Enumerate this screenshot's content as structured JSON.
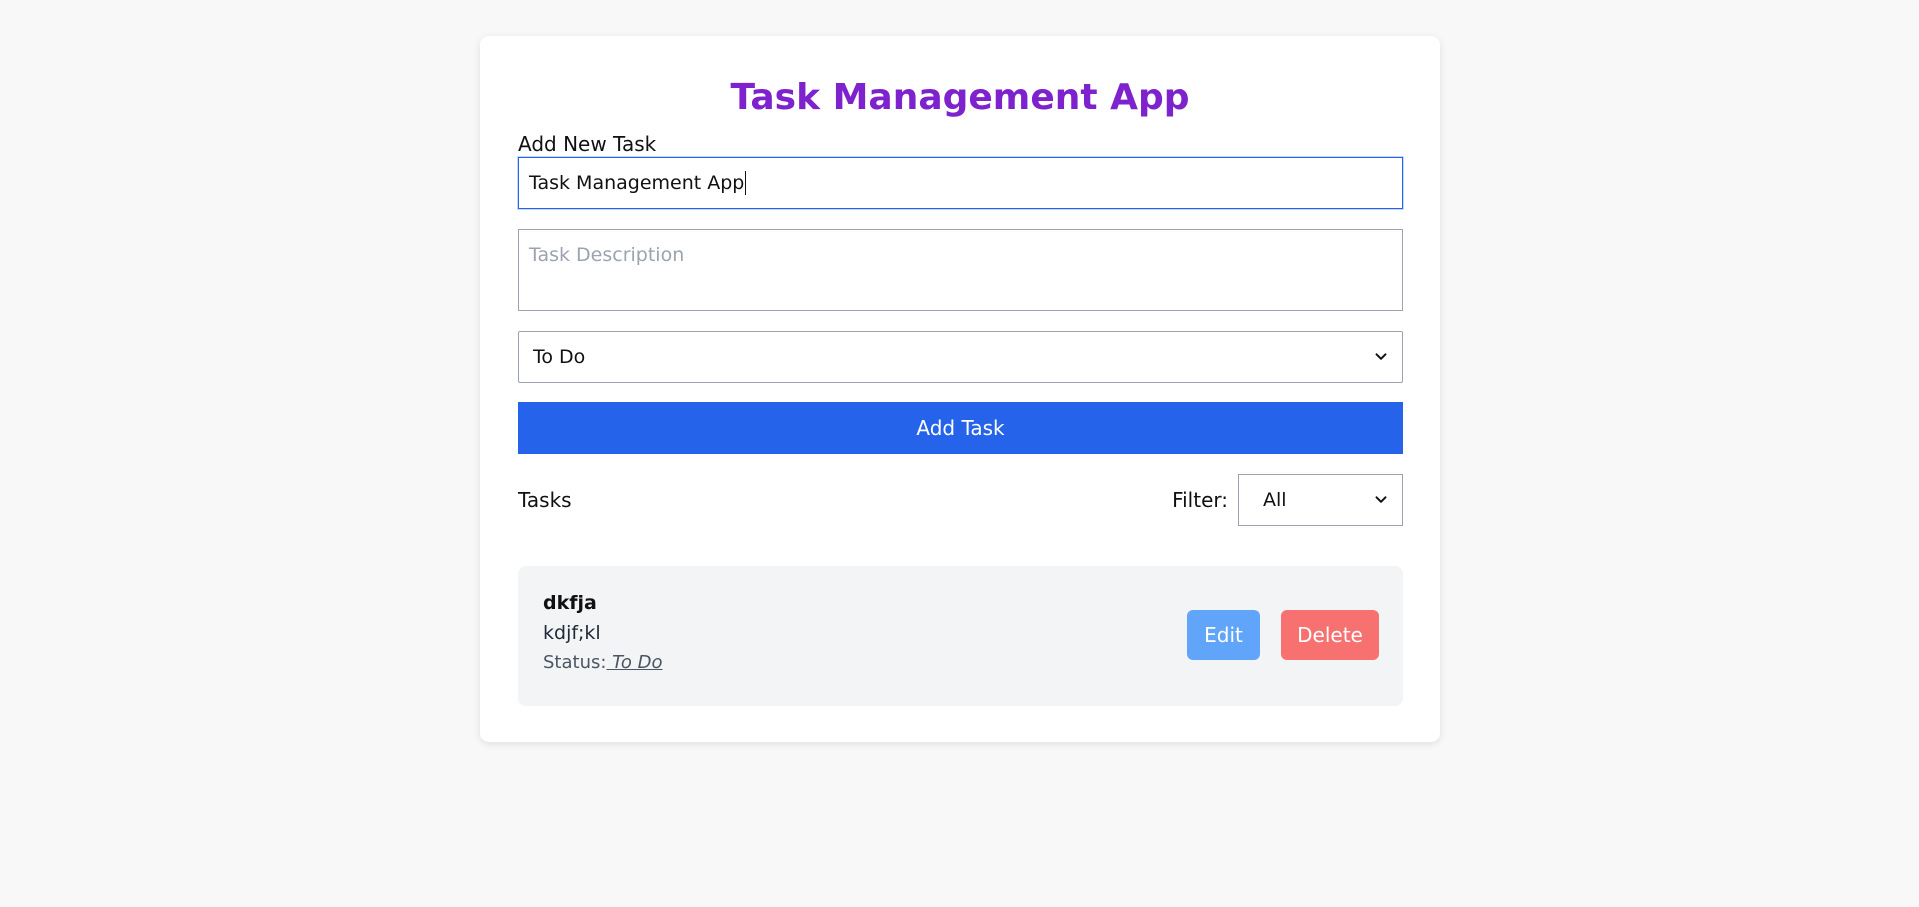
{
  "app": {
    "title": "Task Management App"
  },
  "form": {
    "section_label": "Add New Task",
    "title_value": "Task Management App",
    "description_placeholder": "Task Description",
    "status_selected": "To Do",
    "submit_label": "Add Task"
  },
  "list": {
    "heading": "Tasks",
    "filter_label": "Filter:",
    "filter_selected": "All",
    "tasks": [
      {
        "title": "dkfja",
        "description": "kdjf;kl",
        "status_label": "Status:",
        "status_value": " To Do",
        "edit_label": "Edit",
        "delete_label": "Delete"
      }
    ]
  },
  "colors": {
    "title": "#7e22ce",
    "primary": "#2563eb",
    "edit": "#60a5fa",
    "delete": "#f87171",
    "task_bg": "#f3f4f6"
  }
}
